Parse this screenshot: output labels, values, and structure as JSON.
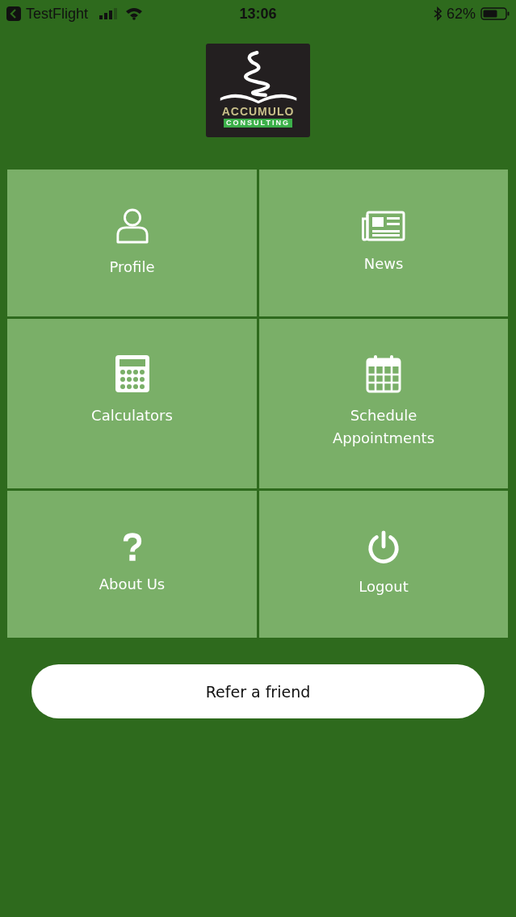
{
  "status_bar": {
    "back_app": "TestFlight",
    "time": "13:06",
    "battery": "62%"
  },
  "logo": {
    "name": "ACCUMULO",
    "tagline": "CONSULTING"
  },
  "tiles": [
    {
      "kind": "profile",
      "label": "Profile"
    },
    {
      "kind": "news",
      "label": "News"
    },
    {
      "kind": "calculator",
      "label": "Calculators"
    },
    {
      "kind": "calendar",
      "label": "Schedule Appointments"
    },
    {
      "kind": "help",
      "label": "About Us"
    },
    {
      "kind": "power",
      "label": "Logout"
    }
  ],
  "refer_button": "Refer a friend"
}
